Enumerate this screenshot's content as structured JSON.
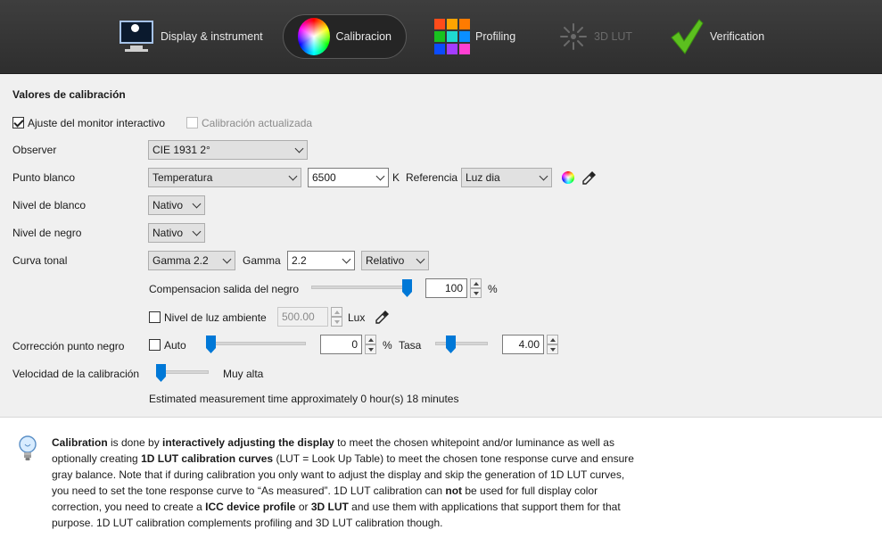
{
  "tabs": [
    {
      "label": "Display & instrument",
      "icon": "display-icon",
      "state": "normal"
    },
    {
      "label": "Calibracion",
      "icon": "color-wheel-icon",
      "state": "active"
    },
    {
      "label": "Profiling",
      "icon": "color-grid-icon",
      "state": "normal"
    },
    {
      "label": "3D LUT",
      "icon": "lut-icon",
      "state": "disabled"
    },
    {
      "label": "Verification",
      "icon": "checkmark-icon",
      "state": "normal"
    }
  ],
  "section": {
    "title": "Valores de calibración"
  },
  "interactive": {
    "label": "Ajuste del monitor interactivo",
    "checked": true
  },
  "updated_cal": {
    "label": "Calibración actualizada",
    "checked": false,
    "disabled": true
  },
  "observer": {
    "label": "Observer",
    "value": "CIE 1931 2°"
  },
  "whitepoint": {
    "label": "Punto blanco",
    "mode": "Temperatura",
    "temperature": "6500",
    "unit": "K",
    "reference_label": "Referencia",
    "reference": "Luz dia"
  },
  "white_level": {
    "label": "Nivel de blanco",
    "value": "Nativo"
  },
  "black_level": {
    "label": "Nivel de negro",
    "value": "Nativo"
  },
  "tone_curve": {
    "label": "Curva tonal",
    "value": "Gamma 2.2",
    "gamma_label": "Gamma",
    "gamma": "2.2",
    "mode": "Relativo"
  },
  "black_output_offset": {
    "label": "Compensacion salida del negro",
    "value": "100",
    "unit": "%",
    "slider_fraction": 1.0
  },
  "ambient": {
    "label": "Nivel de luz ambiente",
    "checked": false,
    "value": "500.00",
    "unit": "Lux"
  },
  "black_point_correction": {
    "label": "Corrección punto negro",
    "auto_label": "Auto",
    "auto_checked": false,
    "value": "0",
    "unit": "%",
    "slider_fraction": 0.0,
    "rate_label": "Tasa",
    "rate": "4.00",
    "rate_slider_fraction": 0.25
  },
  "speed": {
    "label": "Velocidad de la calibración",
    "value": "Muy alta",
    "slider_fraction": 0.0
  },
  "estimate": "Estimated measurement time approximately 0 hour(s) 18 minutes",
  "info": {
    "p1": "Calibration",
    "p2": " is done by ",
    "p3": "interactively adjusting the display",
    "p4": " to meet the chosen whitepoint and/or luminance as well as optionally creating ",
    "p5": "1D LUT calibration curves",
    "p6": " (LUT = Look Up Table) to meet the chosen tone response curve and ensure gray balance. Note that if during calibration you only want to adjust the display and skip the generation of 1D LUT curves, you need to set the tone response curve to “As measured”. 1D LUT calibration can ",
    "p7": "not",
    "p8": " be used for full display color correction, you need to create a ",
    "p9": "ICC device profile",
    "p10": " or ",
    "p11": "3D LUT",
    "p12": " and use them with applications that support them for that purpose. 1D LUT calibration complements profiling and 3D LUT calibration though."
  },
  "colors": {
    "accent": "#0078d7",
    "topbar": "#333333",
    "check_green": "#5cc01f"
  }
}
